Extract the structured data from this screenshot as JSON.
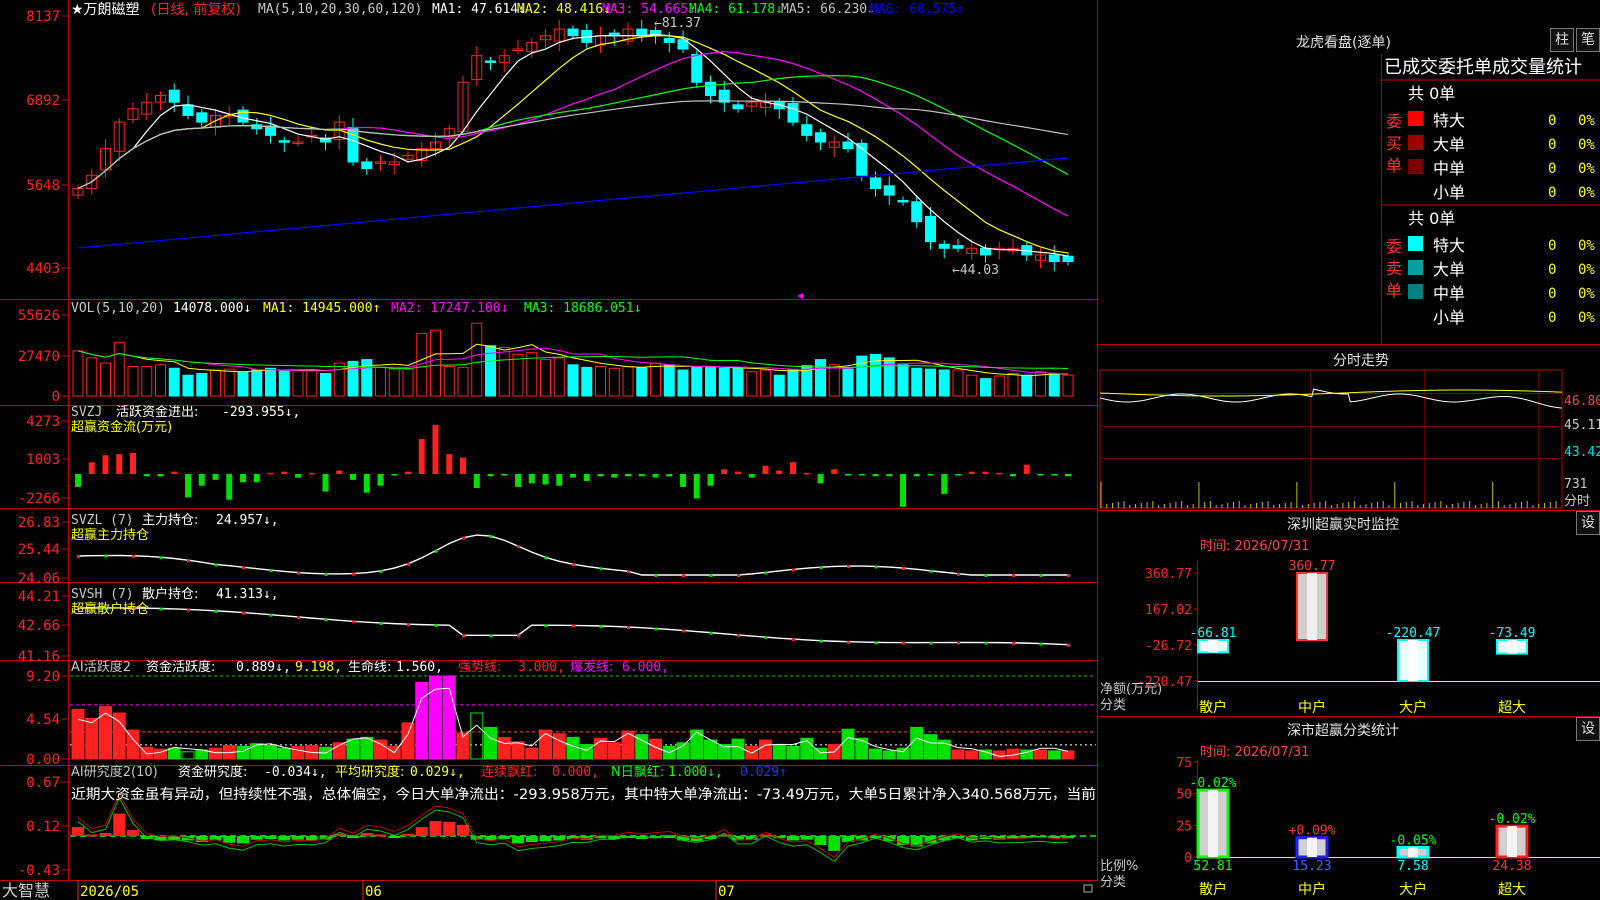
{
  "app": {
    "brand": "大智慧",
    "lock_icon": "lock-icon"
  },
  "stock": {
    "name": "★万朗磁塑",
    "period": "(日线, 前复权)",
    "high_label": "←81.37",
    "low_label": "←44.03"
  },
  "ma_legend": {
    "params": "MA(5,10,20,30,60,120)",
    "items": [
      {
        "label": "MA1: 47.614↓",
        "color": "#ffffff"
      },
      {
        "label": "MA2: 48.416↓",
        "color": "#ffff00"
      },
      {
        "label": "MA3: 54.665↓",
        "color": "#ff00ff"
      },
      {
        "label": "MA4: 61.178↓",
        "color": "#00ff00"
      },
      {
        "label": "MA5: 66.230↓",
        "color": "#c0c0c0"
      },
      {
        "label": "MA6: 60.575↑",
        "color": "#0000ff"
      }
    ]
  },
  "price_axis": [
    "8137",
    "6892",
    "5648",
    "4403"
  ],
  "vol_panel": {
    "title": "VOL(5,10,20)",
    "value": "14078.000↓",
    "items": [
      {
        "label": "MA1: 14945.000↑",
        "color": "#ffff00"
      },
      {
        "label": "MA2: 17247.100↓",
        "color": "#ff00ff"
      },
      {
        "label": "MA3: 18686.051↓",
        "color": "#00ff00"
      }
    ],
    "axis": [
      "55626",
      "27470",
      "0"
    ],
    "values": [
      52,
      44,
      38,
      62,
      34,
      34,
      36,
      32,
      24,
      26,
      30,
      31,
      28,
      30,
      32,
      29,
      30,
      30,
      26,
      38,
      40,
      42,
      33,
      31,
      31,
      72,
      76,
      34,
      33,
      84,
      58,
      56,
      48,
      50,
      42,
      44,
      36,
      33,
      34,
      32,
      34,
      33,
      38,
      36,
      30,
      34,
      33,
      32,
      33,
      28,
      30,
      24,
      30,
      35,
      42,
      36,
      31,
      46,
      48,
      44,
      36,
      32,
      31,
      30,
      30,
      24,
      20,
      23,
      26,
      24,
      28,
      26,
      24
    ]
  },
  "svzj": {
    "title": "SVZJ",
    "label": "活跃资金进出:",
    "value": "-293.955↓,",
    "sub": "超赢资金流(万元)",
    "axis": [
      "4273",
      "1003",
      "-2266"
    ],
    "values": [
      -1100,
      1000,
      1600,
      1700,
      1800,
      -200,
      -200,
      200,
      -2000,
      -1000,
      -500,
      -2200,
      -700,
      -700,
      100,
      200,
      -300,
      100,
      -1500,
      300,
      -500,
      -1600,
      -1000,
      -100,
      200,
      3000,
      4200,
      1700,
      1400,
      -1200,
      -200,
      -100,
      -1100,
      -800,
      -900,
      -1000,
      -300,
      -600,
      -200,
      -300,
      -200,
      -200,
      -300,
      -200,
      -1100,
      -2100,
      -1000,
      400,
      200,
      -300,
      700,
      300,
      1000,
      100,
      -800,
      400,
      -100,
      -100,
      -200,
      -200,
      -2800,
      -200,
      -100,
      -1700,
      -100,
      200,
      200,
      100,
      -200,
      800,
      -100,
      -100,
      -200
    ]
  },
  "svzl": {
    "title": "SVZL (7)",
    "label": "主力持仓:",
    "value": "24.957↓,",
    "sub": "超赢主力持仓",
    "axis": [
      "26.83",
      "25.44",
      "24.06"
    ]
  },
  "svsh": {
    "title": "SVSH (7)",
    "label": "散户持仓:",
    "value": "41.313↓,",
    "sub": "超赢散户持仓",
    "axis": [
      "44.21",
      "42.66",
      "41.16"
    ]
  },
  "ai_active": {
    "title": "AI活跃度2",
    "label": "资金活跃度:",
    "value": "0.889↓,",
    "v2": "9.198,",
    "life_label": "生命线:",
    "life_value": "1.560,",
    "strong_label": "强势线:",
    "strong_value": "3.000,",
    "burst_label": "爆发线:",
    "burst_value": "6.000,",
    "axis": [
      "9.20",
      "4.54",
      "0.00"
    ],
    "values": [
      5.5,
      4.5,
      5.8,
      5.1,
      3.2,
      1.3,
      1.1,
      1.2,
      0.8,
      1.0,
      1.2,
      1.5,
      1.4,
      1.7,
      1.5,
      1.2,
      1.4,
      1.5,
      1.3,
      1.8,
      2.2,
      2.4,
      2.1,
      1.4,
      4.0,
      8.5,
      9.2,
      9.2,
      2.9,
      5.1,
      3.5,
      2.4,
      1.9,
      1.2,
      3.2,
      2.8,
      2.4,
      1.6,
      2.3,
      1.8,
      3.1,
      2.7,
      2.2,
      1.4,
      1.8,
      3.2,
      2.1,
      1.6,
      2.2,
      1.4,
      2.1,
      1.6,
      1.4,
      2.3,
      1.2,
      1.6,
      3.3,
      2.3,
      1.1,
      0.9,
      1.2,
      3.5,
      2.7,
      2.1,
      1.0,
      0.9,
      1.0,
      0.9,
      1.1,
      1.0,
      1.0,
      0.9,
      0.9
    ]
  },
  "ai_research": {
    "title": "AI研究度2(10)",
    "label": "资金研究度:",
    "value": "-0.034↓,",
    "avg_label": "平均研究度:",
    "avg_value": "0.029↓,",
    "cont_label": "连续飘红:",
    "cont_value": "0.000,",
    "nday_label": "N日飘红:",
    "nday_value": "1.000↓,",
    "last_value": "0.029↑",
    "axis": [
      "0.67",
      "0.12",
      "-0.43"
    ],
    "text": "近期大资金虽有异动，但持续性不强，总体偏空，今日大单净流出：-293.958万元，其中特大单净流出：-73.49万元，大单5日累计净入340.568万元，当前",
    "values": [
      0.12,
      0.02,
      0.04,
      0.3,
      0.08,
      -0.04,
      -0.06,
      -0.05,
      -0.06,
      -0.08,
      -0.06,
      -0.09,
      -0.1,
      -0.05,
      -0.04,
      -0.06,
      -0.05,
      -0.06,
      -0.05,
      0.03,
      -0.02,
      0.04,
      0.02,
      -0.02,
      0.03,
      0.12,
      0.2,
      0.19,
      0.15,
      -0.05,
      -0.06,
      -0.04,
      -0.1,
      -0.08,
      -0.07,
      -0.06,
      -0.04,
      -0.05,
      -0.03,
      -0.04,
      -0.02,
      -0.04,
      -0.03,
      -0.02,
      -0.06,
      -0.07,
      -0.04,
      0.02,
      -0.06,
      -0.05,
      0.02,
      -0.03,
      -0.06,
      -0.05,
      -0.12,
      -0.2,
      -0.08,
      -0.06,
      -0.03,
      -0.07,
      -0.12,
      -0.14,
      -0.1,
      -0.06,
      -0.03,
      -0.06,
      -0.04,
      -0.05,
      -0.04,
      -0.03,
      -0.02,
      -0.03,
      -0.03
    ]
  },
  "time_axis": [
    "2026/05",
    "06",
    "07"
  ],
  "dragon_tiger": {
    "title": "龙虎看盘(逐单)",
    "btn_bar": "柱",
    "btn_pen": "笔",
    "header": "已成交委托单成交量统计",
    "buy": {
      "side": "委买单",
      "total": "共 0单",
      "rows": [
        {
          "color": "#ff0000",
          "name": "特大",
          "qty": "0",
          "pct": "0%"
        },
        {
          "color": "#a00000",
          "name": "大单",
          "qty": "0",
          "pct": "0%"
        },
        {
          "color": "#780000",
          "name": "中单",
          "qty": "0",
          "pct": "0%"
        },
        {
          "color": "",
          "name": "小单",
          "qty": "0",
          "pct": "0%"
        }
      ]
    },
    "sell": {
      "side": "委卖单",
      "total": "共 0单",
      "rows": [
        {
          "color": "#00ffff",
          "name": "特大",
          "qty": "0",
          "pct": "0%"
        },
        {
          "color": "#00a0a0",
          "name": "大单",
          "qty": "0",
          "pct": "0%"
        },
        {
          "color": "#008080",
          "name": "中单",
          "qty": "0",
          "pct": "0%"
        },
        {
          "color": "",
          "name": "小单",
          "qty": "0",
          "pct": "0%"
        }
      ]
    }
  },
  "intraday": {
    "title": "分时走势",
    "axis": [
      "46.80",
      "45.11",
      "43.42"
    ],
    "vol": "731",
    "unit": "分时"
  },
  "monitor": {
    "title": "深圳超赢实时监控",
    "settings": "设",
    "time_label": "时间: 2026/07/31",
    "axis": [
      "360.77",
      "167.02",
      "-26.72",
      "-220.47"
    ],
    "ylabel": "净额(万元)",
    "xlabel": "分类",
    "categories": [
      "散户",
      "中户",
      "大户",
      "超大"
    ],
    "values": [
      -66.81,
      360.77,
      -220.47,
      -73.49
    ],
    "labels": [
      "-66.81",
      "360.77",
      "-220.47",
      "-73.49"
    ]
  },
  "classify": {
    "title": "深市超赢分类统计",
    "settings": "设",
    "time_label": "时间: 2026/07/31",
    "axis": [
      "75",
      "50",
      "25",
      "0"
    ],
    "ylabel": "比例%",
    "xlabel": "分类",
    "categories": [
      "散户",
      "中户",
      "大户",
      "超大"
    ],
    "values": [
      52.81,
      15.23,
      7.58,
      24.38
    ],
    "labels": [
      "52.81",
      "15.23",
      "7.58",
      "24.38"
    ],
    "changes": [
      "-0.02%",
      "+0.09%",
      "-0.05%",
      "-0.02%"
    ],
    "bar_colors": [
      "#00ff00",
      "#2020ff",
      "#00ffff",
      "#ff2020"
    ]
  }
}
